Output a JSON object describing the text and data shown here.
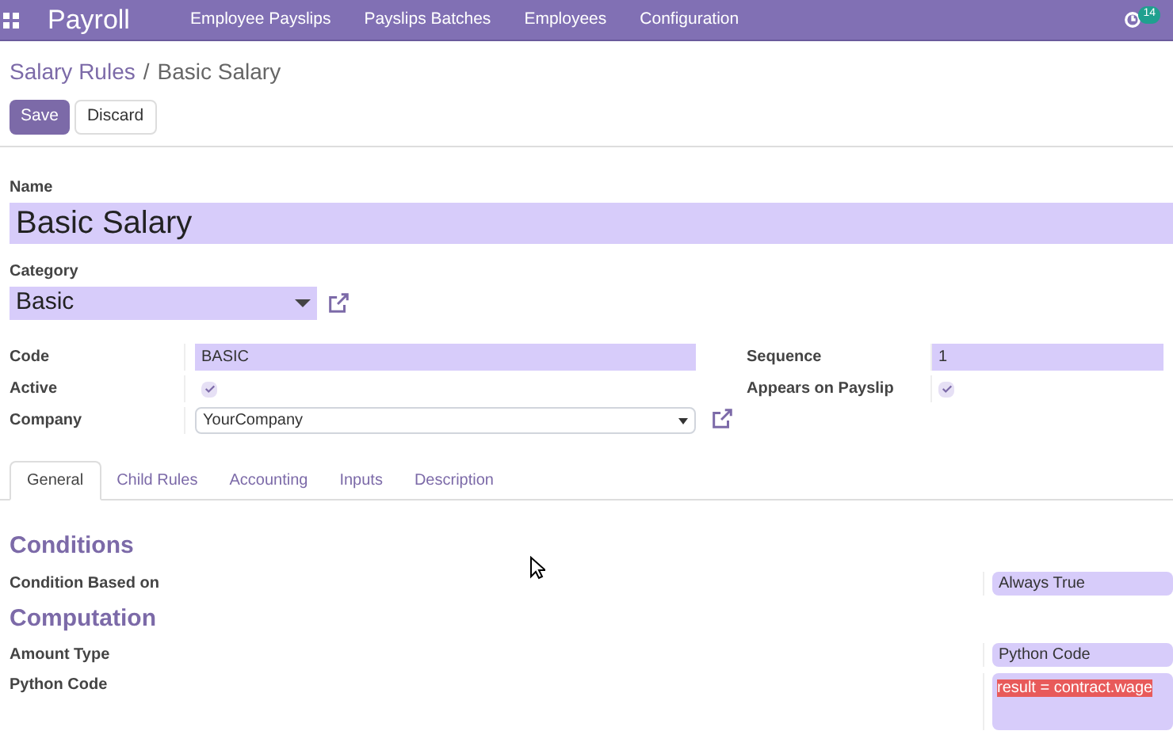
{
  "navbar": {
    "app_title": "Payroll",
    "menu": [
      "Employee Payslips",
      "Payslips Batches",
      "Employees",
      "Configuration"
    ],
    "activity_count": "14"
  },
  "breadcrumb": {
    "parent": "Salary Rules",
    "separator": "/",
    "current": "Basic Salary"
  },
  "buttons": {
    "save": "Save",
    "discard": "Discard"
  },
  "name": {
    "label": "Name",
    "value": "Basic Salary"
  },
  "category": {
    "label": "Category",
    "value": "Basic"
  },
  "left_fields": [
    {
      "kind": "text",
      "label": "Code",
      "value": "BASIC"
    },
    {
      "kind": "checkbox",
      "label": "Active",
      "checked": true
    },
    {
      "kind": "select",
      "label": "Company",
      "value": "YourCompany"
    }
  ],
  "right_fields": [
    {
      "kind": "text",
      "label": "Sequence",
      "value": "1"
    },
    {
      "kind": "checkbox",
      "label": "Appears on Payslip",
      "checked": true
    }
  ],
  "tabs": [
    {
      "label": "General",
      "selected": true
    },
    {
      "label": "Child Rules",
      "selected": false
    },
    {
      "label": "Accounting",
      "selected": false
    },
    {
      "label": "Inputs",
      "selected": false
    },
    {
      "label": "Description",
      "selected": false
    }
  ],
  "sections": [
    {
      "title": "Conditions",
      "fields": [
        {
          "kind": "select",
          "label": "Condition Based on",
          "value": "Always True"
        }
      ]
    },
    {
      "title": "Computation",
      "fields": [
        {
          "kind": "select",
          "label": "Amount Type",
          "value": "Python Code"
        },
        {
          "kind": "code",
          "label": "Python Code",
          "value": "result = contract.wage"
        }
      ]
    }
  ]
}
